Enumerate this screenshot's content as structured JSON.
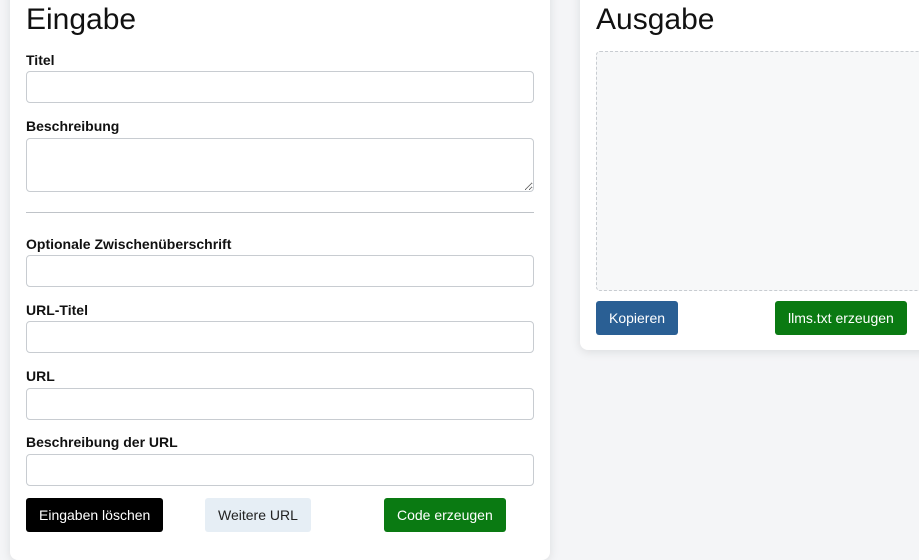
{
  "input_panel": {
    "heading": "Eingabe",
    "fields": {
      "title_label": "Titel",
      "title_value": "",
      "description_label": "Beschreibung",
      "description_value": "",
      "subheading_label": "Optionale Zwischenüberschrift",
      "subheading_value": "",
      "url_title_label": "URL-Titel",
      "url_title_value": "",
      "url_label": "URL",
      "url_value": "",
      "url_description_label": "Beschreibung der URL",
      "url_description_value": ""
    },
    "buttons": {
      "clear": "Eingaben löschen",
      "add_url": "Weitere URL",
      "generate_code": "Code erzeugen"
    }
  },
  "output_panel": {
    "heading": "Ausgabe",
    "output_text": "",
    "buttons": {
      "copy": "Kopieren",
      "generate_llms": "llms.txt erzeugen"
    }
  },
  "colors": {
    "black_button": "#000000",
    "light_button": "#e6eef5",
    "green_button": "#0a7a12",
    "blue_button": "#2a5f94"
  }
}
